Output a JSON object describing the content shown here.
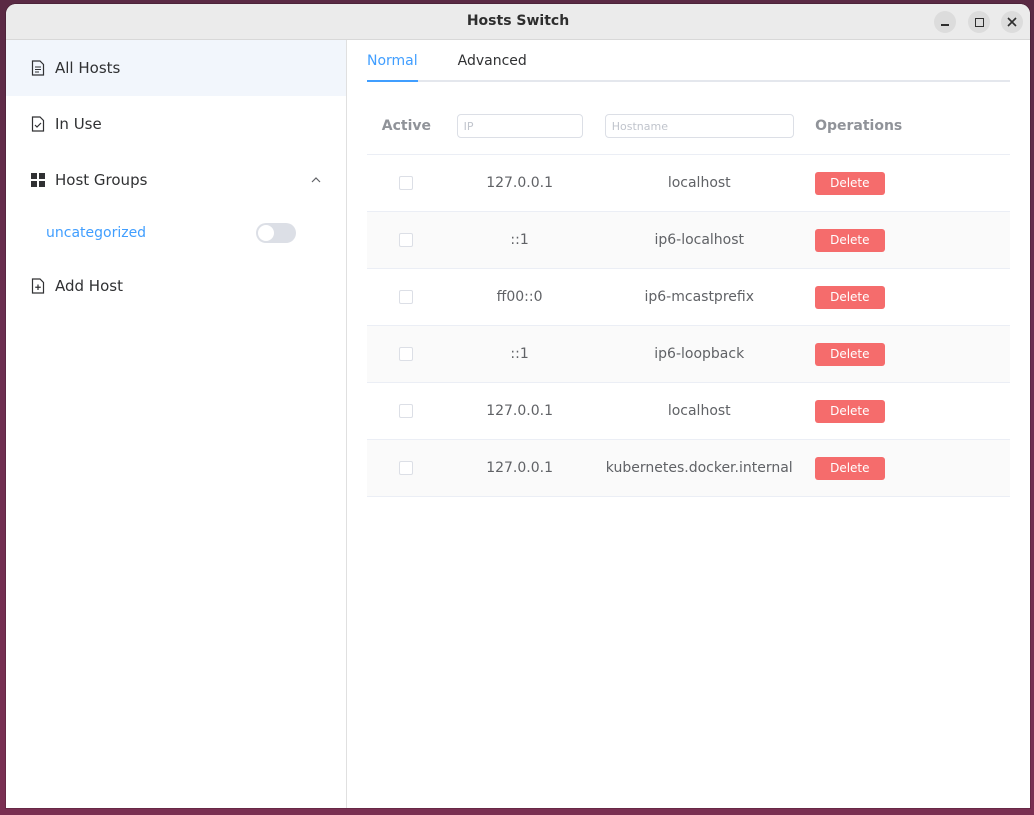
{
  "window": {
    "title": "Hosts Switch"
  },
  "sidebar": {
    "items": [
      {
        "label": "All Hosts",
        "icon": "document-icon"
      },
      {
        "label": "In Use",
        "icon": "document-check-icon"
      },
      {
        "label": "Host Groups",
        "icon": "grid-icon"
      },
      {
        "label": "Add Host",
        "icon": "document-add-icon"
      }
    ],
    "groups": [
      {
        "name": "uncategorized",
        "enabled": false
      }
    ]
  },
  "tabs": [
    {
      "label": "Normal",
      "active": true
    },
    {
      "label": "Advanced",
      "active": false
    }
  ],
  "table": {
    "headers": {
      "active": "Active",
      "ip_placeholder": "IP",
      "hostname_placeholder": "Hostname",
      "operations": "Operations"
    },
    "delete_label": "Delete",
    "rows": [
      {
        "ip": "127.0.0.1",
        "hostname": "localhost",
        "active": false
      },
      {
        "ip": "::1",
        "hostname": "ip6-localhost",
        "active": false
      },
      {
        "ip": "ff00::0",
        "hostname": "ip6-mcastprefix",
        "active": false
      },
      {
        "ip": "::1",
        "hostname": "ip6-loopback",
        "active": false
      },
      {
        "ip": "127.0.0.1",
        "hostname": "localhost",
        "active": false
      },
      {
        "ip": "127.0.0.1",
        "hostname": "kubernetes.docker.internal",
        "active": false
      }
    ]
  },
  "colors": {
    "accent": "#409eff",
    "danger": "#f56c6c"
  }
}
